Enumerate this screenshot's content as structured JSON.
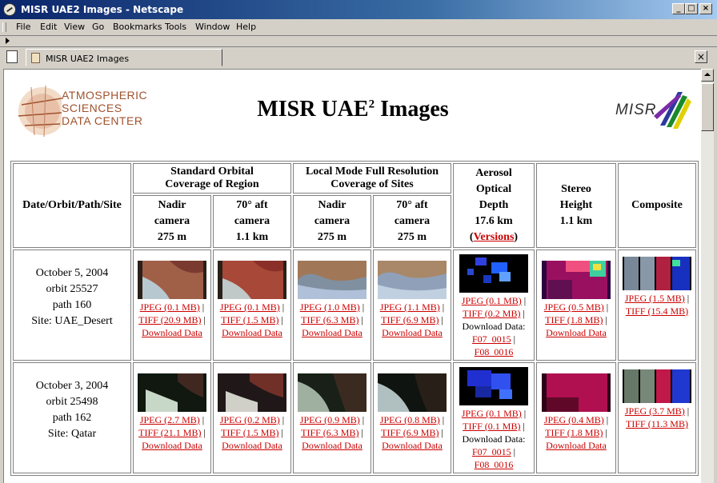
{
  "window": {
    "title": "MISR UAE2 Images - Netscape"
  },
  "menu": [
    "File",
    "Edit",
    "View",
    "Go",
    "Bookmarks",
    "Tools",
    "Window",
    "Help"
  ],
  "tab": {
    "label": "MISR UAE2 Images"
  },
  "logo": {
    "line1": "ATMOSPHERIC",
    "line2": "SCIENCES",
    "line3": "DATA CENTER",
    "misr": "MISR"
  },
  "page": {
    "title_main": "MISR UAE",
    "title_sup": "2",
    "title_tail": " Images"
  },
  "table": {
    "col_date": "Date/Orbit/Path/Site",
    "group_standard_1": "Standard Orbital",
    "group_standard_2": "Coverage of Region",
    "group_local_1": "Local Mode Full Resolution",
    "group_local_2": "Coverage of Sites",
    "aerosol_1": "Aerosol",
    "aerosol_2": "Optical",
    "aerosol_3": "Depth",
    "aerosol_4": "17.6 km",
    "aerosol_versions": "Versions",
    "stereo_1": "Stereo",
    "stereo_2": "Height",
    "stereo_3": "1.1 km",
    "composite": "Composite",
    "nadir_1": "Nadir",
    "nadir_2": "camera",
    "nadir_3": "275 m",
    "aft_1": "70° aft",
    "aft_2": "camera",
    "aft_3_std": "1.1 km",
    "aft_3_local": "275 m",
    "download_label": "Download Data:",
    "rows": [
      {
        "date": "October 5, 2004",
        "orbit": "orbit 25527",
        "path": "path 160",
        "site": "Site: UAE_Desert",
        "std_nadir": {
          "jpeg": "JPEG (0.1 MB)",
          "tiff": "TIFF (20.9 MB)",
          "dl": "Download Data"
        },
        "std_aft": {
          "jpeg": "JPEG (0.1 MB)",
          "tiff": "TIFF (1.5 MB)",
          "dl": "Download Data"
        },
        "loc_nadir": {
          "jpeg": "JPEG (1.0 MB)",
          "tiff": "TIFF (6.3 MB)",
          "dl": "Download Data"
        },
        "loc_aft": {
          "jpeg": "JPEG (1.1 MB)",
          "tiff": "TIFF (6.9 MB)",
          "dl": "Download Data"
        },
        "aerosol": {
          "jpeg": "JPEG (0.1 MB)",
          "tiff": "TIFF (0.2 MB)",
          "f1": "F07_0015",
          "f2": "F08_0016"
        },
        "stereo": {
          "jpeg": "JPEG (0.5 MB)",
          "tiff": "TIFF (1.8 MB)",
          "dl": "Download Data"
        },
        "composite": {
          "jpeg": "JPEG (1.5 MB)",
          "tiff": "TIFF (15.4 MB)"
        }
      },
      {
        "date": "October 3, 2004",
        "orbit": "orbit 25498",
        "path": "path 162",
        "site": "Site: Qatar",
        "std_nadir": {
          "jpeg": "JPEG (2.7 MB)",
          "tiff": "TIFF (21.1 MB)",
          "dl": "Download Data"
        },
        "std_aft": {
          "jpeg": "JPEG (0.2 MB)",
          "tiff": "TIFF (1.5 MB)",
          "dl": "Download Data"
        },
        "loc_nadir": {
          "jpeg": "JPEG (0.9 MB)",
          "tiff": "TIFF (6.3 MB)",
          "dl": "Download Data"
        },
        "loc_aft": {
          "jpeg": "JPEG (0.8 MB)",
          "tiff": "TIFF (6.9 MB)",
          "dl": "Download Data"
        },
        "aerosol": {
          "jpeg": "JPEG (0.1 MB)",
          "tiff": "TIFF (0.1 MB)",
          "f1": "F07_0015",
          "f2": "F08_0016"
        },
        "stereo": {
          "jpeg": "JPEG (0.4 MB)",
          "tiff": "TIFF (1.8 MB)",
          "dl": "Download Data"
        },
        "composite": {
          "jpeg": "JPEG (3.7 MB)",
          "tiff": "TIFF (11.3 MB)"
        }
      }
    ]
  }
}
